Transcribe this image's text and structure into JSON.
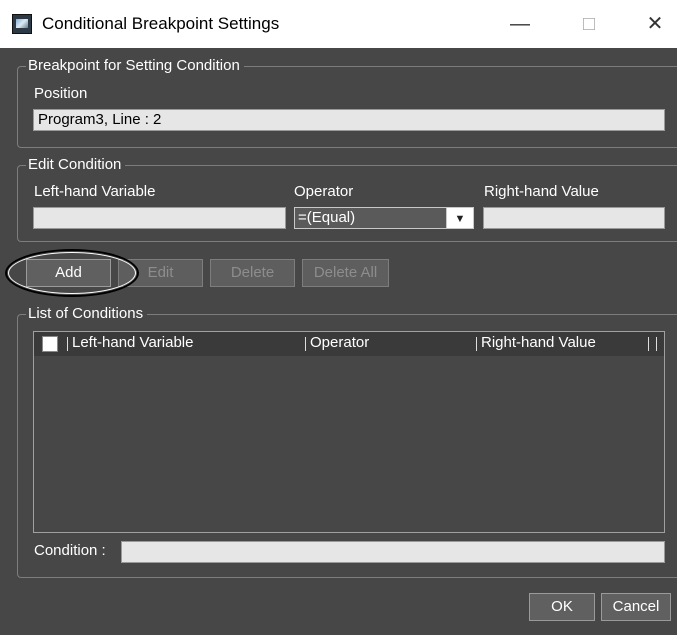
{
  "window": {
    "title": "Conditional Breakpoint Settings",
    "minimize": "—",
    "maximize": "□",
    "close": "✕"
  },
  "breakpoint_group": {
    "title": "Breakpoint for Setting Condition",
    "position_label": "Position",
    "position_value": "Program3, Line : 2"
  },
  "edit_group": {
    "title": "Edit Condition",
    "left_label": "Left-hand Variable",
    "operator_label": "Operator",
    "right_label": "Right-hand Value",
    "left_value": "",
    "operator_value": "=(Equal)",
    "right_value": ""
  },
  "buttons": {
    "add": "Add",
    "edit": "Edit",
    "delete": "Delete",
    "delete_all": "Delete All"
  },
  "list_group": {
    "title": "List of Conditions",
    "columns": [
      "Left-hand Variable",
      "Operator",
      "Right-hand Value"
    ],
    "rows": [],
    "condition_label": "Condition :",
    "condition_value": ""
  },
  "footer": {
    "ok": "OK",
    "cancel": "Cancel"
  }
}
